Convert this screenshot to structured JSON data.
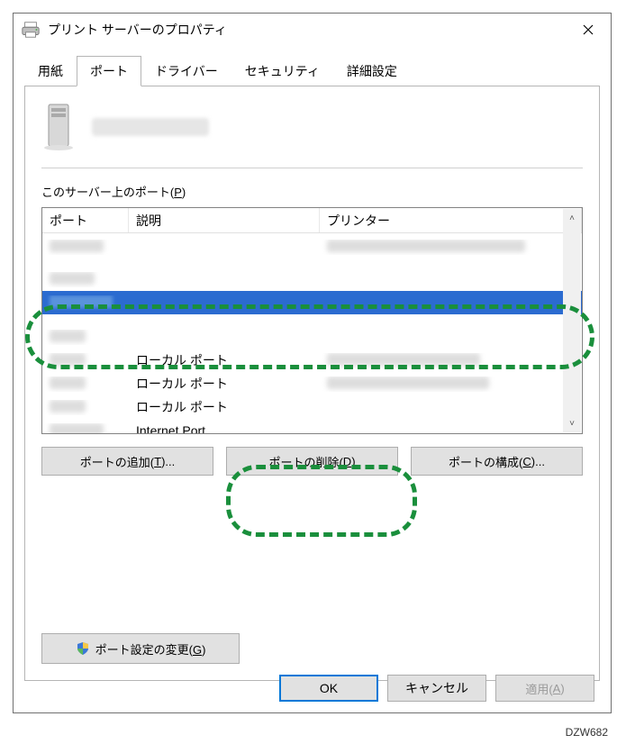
{
  "window": {
    "title": "プリント サーバーのプロパティ"
  },
  "tabs": [
    {
      "label": "用紙"
    },
    {
      "label": "ポート"
    },
    {
      "label": "ドライバー"
    },
    {
      "label": "セキュリティ"
    },
    {
      "label": "詳細設定"
    }
  ],
  "ports_label_prefix": "このサーバー上のポート(",
  "ports_label_key": "P",
  "ports_label_suffix": ")",
  "columns": {
    "port": "ポート",
    "desc": "説明",
    "printer": "プリンター"
  },
  "rows": [
    {
      "port": "",
      "desc": "",
      "printer": "",
      "blurred": true
    },
    {
      "port": "",
      "desc": "",
      "printer": "",
      "blurred": true
    },
    {
      "port": "",
      "desc": "",
      "printer": "",
      "selected": true,
      "blurred": true
    },
    {
      "port": "",
      "desc": "",
      "printer": "",
      "blurred": true
    },
    {
      "port": "",
      "desc": "ローカル ポート",
      "printer": ""
    },
    {
      "port": "",
      "desc": "ローカル ポート",
      "printer": ""
    },
    {
      "port": "",
      "desc": "ローカル ポート",
      "printer": ""
    },
    {
      "port": "",
      "desc": "Internet Port",
      "printer": ""
    }
  ],
  "buttons": {
    "add": {
      "text": "ポートの追加(",
      "key": "T",
      "suffix": ")..."
    },
    "delete": {
      "text": "ポートの削除(",
      "key": "D",
      "suffix": ")"
    },
    "configure": {
      "text": "ポートの構成(",
      "key": "C",
      "suffix": ")..."
    },
    "change_settings": {
      "text": "ポート設定の変更(",
      "key": "G",
      "suffix": ")"
    },
    "ok": "OK",
    "cancel": "キャンセル",
    "apply": {
      "text": "適用(",
      "key": "A",
      "suffix": ")"
    }
  },
  "footer_id": "DZW682"
}
